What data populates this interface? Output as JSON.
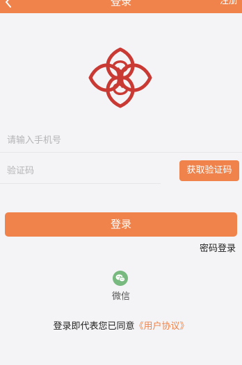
{
  "nav": {
    "title": "登录",
    "register_label": "注册",
    "back_icon": "chevron-left-icon"
  },
  "logo": {
    "icon": "quatrefoil-logo-icon",
    "color": "#c93a34"
  },
  "form": {
    "phone_placeholder": "请输入手机号",
    "phone_value": "",
    "code_placeholder": "验证码",
    "code_value": "",
    "get_code_label": "获取验证码"
  },
  "login_label": "登录",
  "password_login_label": "密码登录",
  "social": {
    "wechat_label": "微信",
    "wechat_icon": "wechat-icon"
  },
  "agreement": {
    "text": "登录即代表您已同意",
    "link": "《用户协议》"
  },
  "colors": {
    "accent": "#f0834b",
    "background": "#f4f4f6",
    "logo": "#c93a34",
    "wechat": "#78b97f"
  }
}
